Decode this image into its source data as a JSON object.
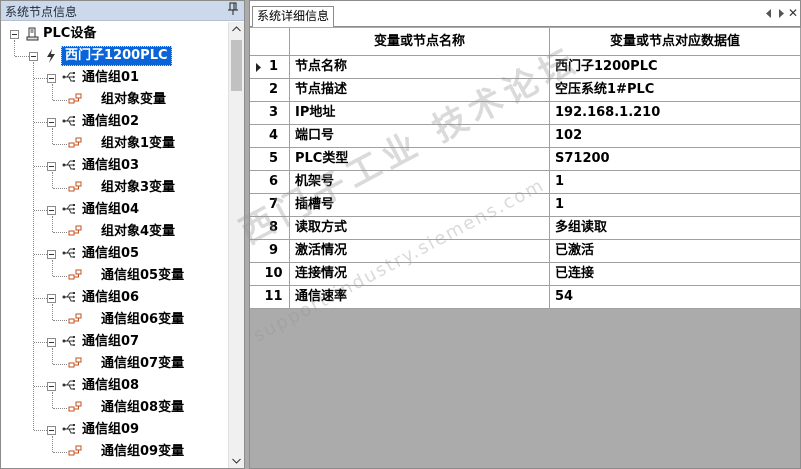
{
  "left_panel": {
    "title": "系统节点信息",
    "root": {
      "label": "PLC设备",
      "icon": "plc-device-icon"
    },
    "device": {
      "label": "西门子1200PLC",
      "icon": "lightning-icon",
      "selected": true
    },
    "groups": [
      {
        "label": "通信组01",
        "child": "组对象变量"
      },
      {
        "label": "通信组02",
        "child": "组对象1变量"
      },
      {
        "label": "通信组03",
        "child": "组对象3变量"
      },
      {
        "label": "通信组04",
        "child": "组对象4变量"
      },
      {
        "label": "通信组05",
        "child": "通信组05变量"
      },
      {
        "label": "通信组06",
        "child": "通信组06变量"
      },
      {
        "label": "通信组07",
        "child": "通信组07变量"
      },
      {
        "label": "通信组08",
        "child": "通信组08变量"
      },
      {
        "label": "通信组09",
        "child": "通信组09变量"
      }
    ]
  },
  "right_panel": {
    "tab": "系统详细信息",
    "columns": [
      "变量或节点名称",
      "变量或节点对应数据值"
    ],
    "rows": [
      {
        "idx": "1",
        "name": "节点名称",
        "value": "西门子1200PLC",
        "current": true
      },
      {
        "idx": "2",
        "name": "节点描述",
        "value": "空压系统1#PLC"
      },
      {
        "idx": "3",
        "name": "IP地址",
        "value": "192.168.1.210"
      },
      {
        "idx": "4",
        "name": "端口号",
        "value": "102"
      },
      {
        "idx": "5",
        "name": "PLC类型",
        "value": "S71200"
      },
      {
        "idx": "6",
        "name": "机架号",
        "value": "1"
      },
      {
        "idx": "7",
        "name": "插槽号",
        "value": "1"
      },
      {
        "idx": "8",
        "name": "读取方式",
        "value": "多组读取"
      },
      {
        "idx": "9",
        "name": "激活情况",
        "value": "已激活"
      },
      {
        "idx": "10",
        "name": "连接情况",
        "value": "已连接"
      },
      {
        "idx": "11",
        "name": "通信速率",
        "value": "54"
      }
    ]
  },
  "watermark": {
    "line1": "西门子工业 技术论坛",
    "line2": "support.industry.siemens.com"
  },
  "colors": {
    "selection": "#0a64d8",
    "title_bar": "#ccd9ea",
    "background": "#ababab"
  }
}
